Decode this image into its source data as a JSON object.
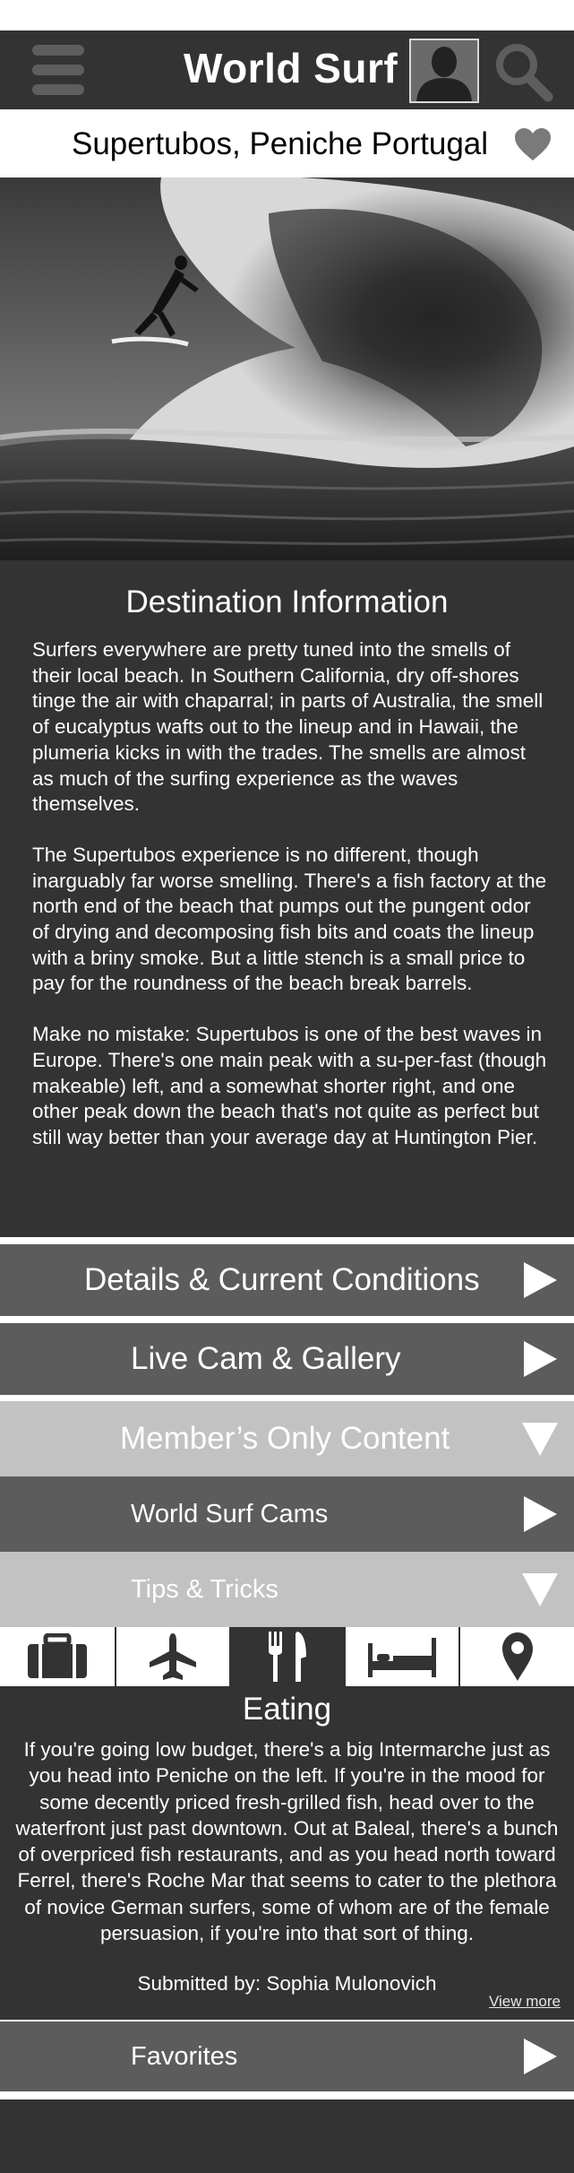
{
  "header": {
    "app_title": "World Surf",
    "menu_icon": "hamburger-menu-icon",
    "avatar_icon": "user-avatar-icon",
    "search_icon": "search-icon"
  },
  "location": {
    "title": "Supertubos, Peniche Portugal",
    "favorite_icon": "heart-icon"
  },
  "destination": {
    "heading": "Destination Information",
    "paragraphs": [
      "Surfers everywhere are pretty tuned into the smells of their local beach. In Southern California, dry off-shores tinge the air with chaparral; in parts of Australia, the smell of eucalyptus wafts out to the lineup and in Hawaii, the plumeria kicks in with the trades. The smells are almost as much of the surfing experience as the waves themselves.",
      "The Supertubos experience is no different, though inarguably far worse smelling. There's a fish factory at the north end of the beach that pumps out the pungent odor of drying and decomposing fish bits and coats the lineup with a briny smoke. But a little stench is a small price to pay for the roundness of the beach break barrels.",
      "Make no mistake: Supertubos is one of the best waves in Europe. There's one main peak with a su-per-fast (though makeable) left, and a somewhat shorter right, and one other peak down the beach that's not quite as perfect but still way better than your average day at Huntington Pier."
    ]
  },
  "sections": {
    "details": "Details & Current Conditions",
    "live_cam": "Live Cam & Gallery",
    "members": "Member’s Only Content",
    "world_cams": "World Surf Cams",
    "tips": "Tips & Tricks",
    "favorites": "Favorites"
  },
  "tip_tabs": [
    {
      "icon": "luggage-icon",
      "active": false
    },
    {
      "icon": "airplane-icon",
      "active": false
    },
    {
      "icon": "fork-knife-icon",
      "active": true
    },
    {
      "icon": "bed-icon",
      "active": false
    },
    {
      "icon": "map-pin-icon",
      "active": false
    }
  ],
  "eating": {
    "heading": "Eating",
    "body": "If you're going low budget, there's a big Intermarche just as you head into Peniche on the left. If you're in the mood for some decently priced fresh-grilled fish, head over to the waterfront just past downtown. Out at Baleal, there's a bunch of overpriced fish restaurants, and as you head north toward Ferrel, there's Roche Mar that seems to cater to the plethora of novice German surfers, some of whom are of the female persuasion, if you're into that sort of thing.",
    "credit": "Submitted by: Sophia Mulonovich",
    "view_more": "View more"
  },
  "colors": {
    "dark": "#333333",
    "mid": "#5c5c5c",
    "light": "#c2c2c2"
  }
}
